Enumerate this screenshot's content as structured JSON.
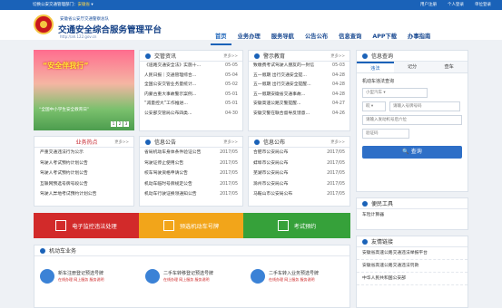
{
  "topbar": {
    "switch_text": "切换公安交通管理部门：",
    "region": "安徽省",
    "links": [
      "用户注册",
      "个人登录",
      "单位登录"
    ]
  },
  "header": {
    "subtitle": "安徽省公安厅交通警察总队",
    "title": "交通安全综合服务管理平台",
    "url": "http://ah.122.gov.cn"
  },
  "nav": [
    "首页",
    "业务办理",
    "服务导航",
    "公告公布",
    "信息查询",
    "APP下载",
    "办事指南"
  ],
  "banner": {
    "headline": "“安全伴我行”",
    "caption": "“全国中小学生安全教育日”",
    "pages": [
      "1",
      "2",
      "3"
    ]
  },
  "traffic_news": {
    "title": "交管资讯",
    "more": "更多>>",
    "items": [
      {
        "t": "《道路交通安全法》实施十...",
        "d": "05-05"
      },
      {
        "t": "人民日报｜交通管理综合...",
        "d": "05-04"
      },
      {
        "t": "全国公安交管业务量统计...",
        "d": "05-02"
      },
      {
        "t": "内蒙古重大事故警示案例...",
        "d": "05-01"
      },
      {
        "t": "“减量控大”工作推进...",
        "d": "05-01"
      },
      {
        "t": "公安部交管局公布四类...",
        "d": "04-30"
      }
    ]
  },
  "warning_edu": {
    "title": "警示教育",
    "more": "更多>>",
    "items": [
      {
        "t": "致缴费考试驾驶人朋友的一封信",
        "d": "05-03"
      },
      {
        "t": "五一假期 出行交通安全提...",
        "d": "04-28"
      },
      {
        "t": "五一假期 出行交通安全提醒...",
        "d": "04-28"
      },
      {
        "t": "五一假期安徽省交通事故...",
        "d": "04-28"
      },
      {
        "t": "安徽高速公路交警提醒...",
        "d": "04-27"
      },
      {
        "t": "安徽交警在联合督导反馈意...",
        "d": "04-26"
      }
    ]
  },
  "hot": {
    "title": "业务热点",
    "more": "更多>>",
    "items": [
      "严重交通违法行为公示",
      "驾驶人考试预约计划公告",
      "驾驶人考试预约计划公告",
      "互联网预选号牌号段公告",
      "驾驶人异地考试预约计划公告"
    ]
  },
  "notices": {
    "title": "信息公告",
    "more": "更多>>",
    "items": [
      {
        "t": "省局机动车身体条件验证公告",
        "d": "2017/05"
      },
      {
        "t": "驾驶证停止使用公告",
        "d": "2017/05"
      },
      {
        "t": "校车驾驶资格申请公告",
        "d": "2017/05"
      },
      {
        "t": "机动车临时号牌规定公告",
        "d": "2017/05"
      },
      {
        "t": "机动车行驶证换领通知公告",
        "d": "2017/05"
      }
    ]
  },
  "releases": {
    "title": "信息公布",
    "more": "更多>>",
    "items": [
      {
        "t": "合肥市公安局公布",
        "d": "2017/05"
      },
      {
        "t": "蚌埠市公安局公布",
        "d": "2017/05"
      },
      {
        "t": "芜湖市公安局公布",
        "d": "2017/05"
      },
      {
        "t": "滁州市公安局公布",
        "d": "2017/05"
      },
      {
        "t": "马鞍山市公安局公布",
        "d": "2017/05"
      }
    ]
  },
  "query": {
    "title": "信息查询",
    "tabs": [
      "违法",
      "记分",
      "查车"
    ],
    "label": "机动车违法查询",
    "vehicle_type": "小型汽车",
    "province": "皖",
    "plate_placeholder": "请输入号牌号码",
    "vin_placeholder": "请输入发动机号后六位",
    "captcha_placeholder": "验证码",
    "button": "查询"
  },
  "tools": {
    "title": "便民工具",
    "items": [
      "车险计算器"
    ]
  },
  "links": {
    "title": "友情链接",
    "items": [
      "安徽省高速公路交通违法举报平台",
      "安徽省高速公路交通违法罚款",
      "中华人民共和国公安部"
    ]
  },
  "strips": [
    {
      "label": "电子监控违法处理",
      "color": "#d22a2a"
    },
    {
      "label": "预选机动车号牌",
      "color": "#f2a51a"
    },
    {
      "label": "考试预约",
      "color": "#36a13a"
    }
  ],
  "vehicle": {
    "title": "机动车业务",
    "services": [
      {
        "name": "新车注册登记预选号牌",
        "sub": "在线办理 网上服务 服务说明"
      },
      {
        "name": "二手车转移登记预选号牌",
        "sub": "在线办理 网上服务 服务说明"
      },
      {
        "name": "二手车转入业务预选号牌",
        "sub": "在线办理 网上服务 服务说明"
      }
    ]
  }
}
